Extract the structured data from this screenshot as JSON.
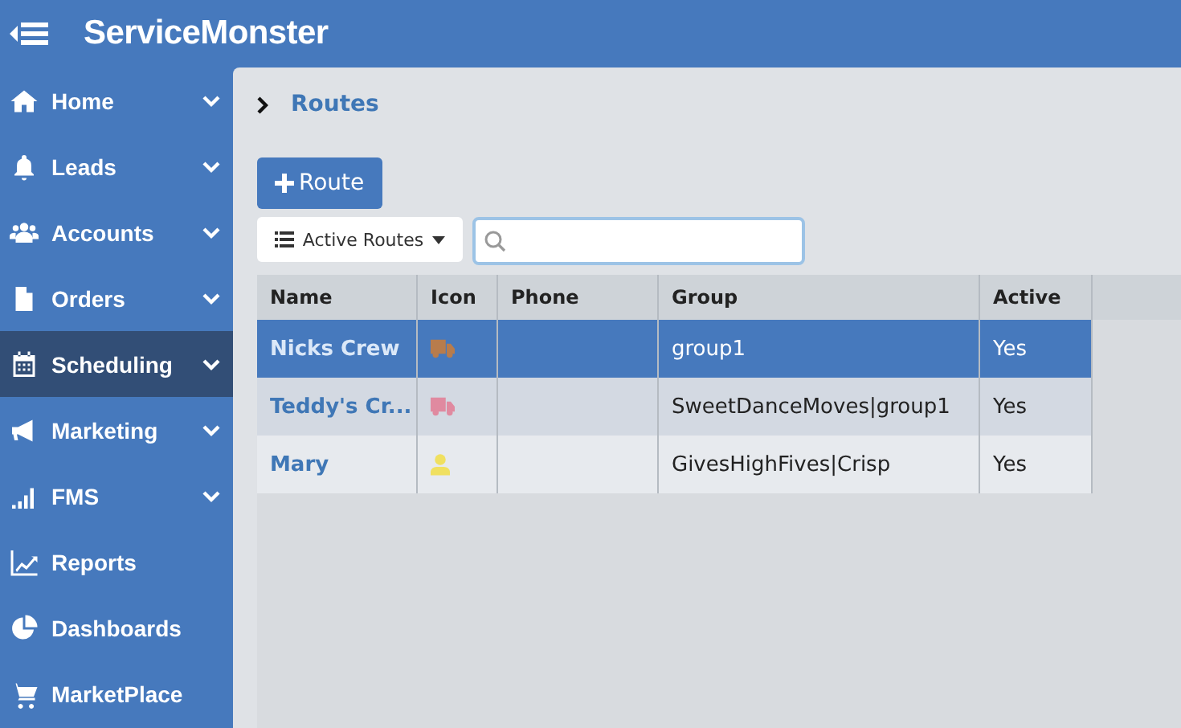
{
  "app": {
    "title": "ServiceMonster"
  },
  "sidebar": {
    "items": [
      {
        "label": "Home",
        "has_submenu": true,
        "selected": false
      },
      {
        "label": "Leads",
        "has_submenu": true,
        "selected": false
      },
      {
        "label": "Accounts",
        "has_submenu": true,
        "selected": false
      },
      {
        "label": "Orders",
        "has_submenu": true,
        "selected": false
      },
      {
        "label": "Scheduling",
        "has_submenu": true,
        "selected": true
      },
      {
        "label": "Marketing",
        "has_submenu": true,
        "selected": false
      },
      {
        "label": "FMS",
        "has_submenu": true,
        "selected": false
      },
      {
        "label": "Reports",
        "has_submenu": false,
        "selected": false
      },
      {
        "label": "Dashboards",
        "has_submenu": false,
        "selected": false
      },
      {
        "label": "MarketPlace",
        "has_submenu": false,
        "selected": false
      }
    ]
  },
  "breadcrumb": "Routes",
  "add_button": "Route",
  "filter": {
    "label": "Active Routes"
  },
  "table": {
    "columns": [
      "Name",
      "Icon",
      "Phone",
      "Group",
      "Active"
    ],
    "rows": [
      {
        "name": "Nicks Crew",
        "icon": {
          "kind": "truck",
          "color": "#b87c4c"
        },
        "group": "group1",
        "active": "Yes",
        "selected": true
      },
      {
        "name": "Teddy's Cr...",
        "icon": {
          "kind": "truck",
          "color": "#e08aa0"
        },
        "group": "SweetDanceMoves|group1",
        "active": "Yes",
        "selected": false
      },
      {
        "name": "Mary",
        "icon": {
          "kind": "person",
          "color": "#f0e060"
        },
        "group": "GivesHighFives|Crisp",
        "active": "Yes",
        "selected": false
      }
    ]
  }
}
